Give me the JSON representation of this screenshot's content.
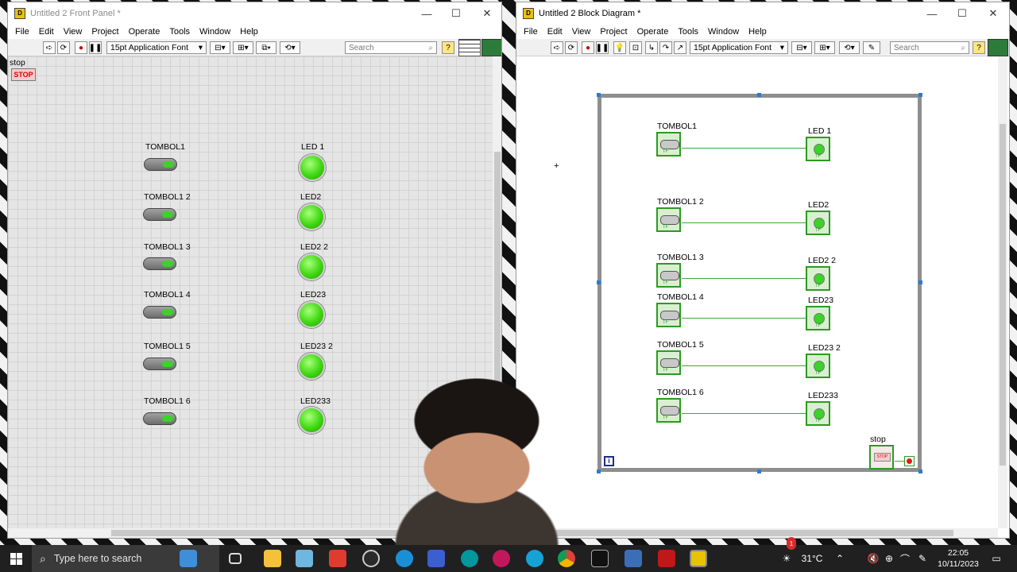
{
  "front_panel": {
    "title": "Untitled 2 Front Panel *",
    "menus": [
      "File",
      "Edit",
      "View",
      "Project",
      "Operate",
      "Tools",
      "Window",
      "Help"
    ],
    "font_select": "15pt Application Font",
    "search_placeholder": "Search",
    "stop_label": "stop",
    "stop_button": "STOP",
    "buttons": [
      "TOMBOL1",
      "TOMBOL1 2",
      "TOMBOL1 3",
      "TOMBOL1 4",
      "TOMBOL1 5",
      "TOMBOL1 6"
    ],
    "leds": [
      "LED 1",
      "LED2",
      "LED2 2",
      "LED23",
      "LED23 2",
      "LED233"
    ]
  },
  "block_diagram": {
    "title": "Untitled 2 Block Diagram *",
    "menus": [
      "File",
      "Edit",
      "View",
      "Project",
      "Operate",
      "Tools",
      "Window",
      "Help"
    ],
    "font_select": "15pt Application Font",
    "search_placeholder": "Search",
    "controls": [
      "TOMBOL1",
      "TOMBOL1 2",
      "TOMBOL1 3",
      "TOMBOL1 4",
      "TOMBOL1 5",
      "TOMBOL1 6"
    ],
    "indicators": [
      "LED 1",
      "LED2",
      "LED2 2",
      "LED23",
      "LED23 2",
      "LED233"
    ],
    "stop_label": "stop",
    "iteration_terminal": "i"
  },
  "window_controls": {
    "minimize": "—",
    "maximize": "☐",
    "close": "✕"
  },
  "taskbar": {
    "search_placeholder": "Type here to search",
    "temperature": "31°C",
    "time": "22:05",
    "date": "10/11/2023",
    "notification_count": "1"
  },
  "colors": {
    "led_on": "#3fd811",
    "wire": "#3ea73a",
    "loop_border": "#8e8e8e",
    "stop_text": "#dd0000"
  }
}
